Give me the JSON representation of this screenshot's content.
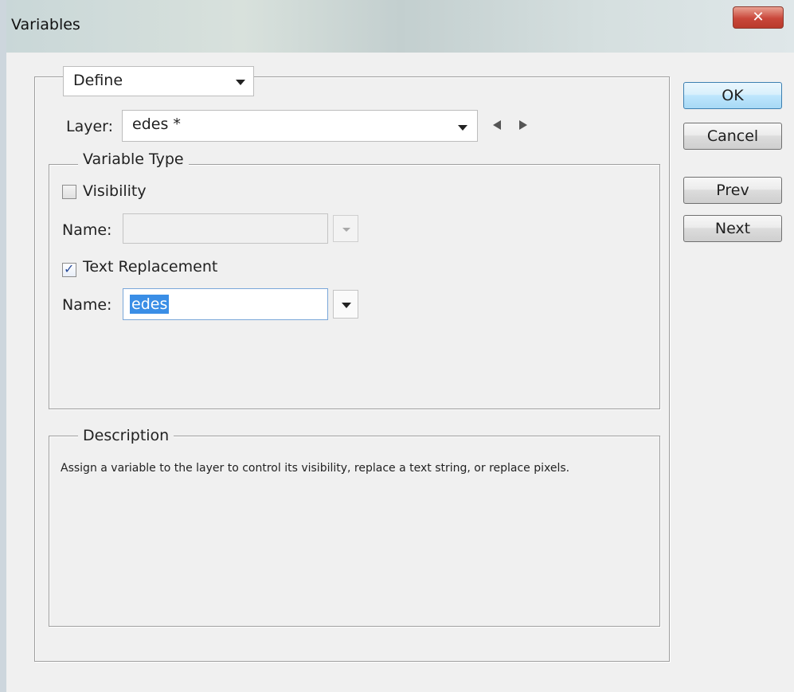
{
  "window": {
    "title": "Variables",
    "close_glyph": "✕"
  },
  "define": {
    "selected": "Define"
  },
  "layer": {
    "label": "Layer:",
    "selected": "edes *"
  },
  "variable_type": {
    "legend": "Variable Type",
    "visibility": {
      "label": "Visibility",
      "checked": false,
      "name_label": "Name:",
      "name_value": ""
    },
    "text_replacement": {
      "label": "Text Replacement",
      "checked": true,
      "check_glyph": "✓",
      "name_label": "Name:",
      "name_value": "edes"
    }
  },
  "description": {
    "legend": "Description",
    "text": "Assign a variable to the layer to control its visibility, replace a text string, or replace pixels."
  },
  "buttons": {
    "ok": "OK",
    "cancel": "Cancel",
    "prev": "Prev",
    "next": "Next"
  },
  "colors": {
    "close_button": "#c9473a",
    "selection_highlight": "#3a8ee6",
    "default_button_border": "#3c7fb1"
  }
}
